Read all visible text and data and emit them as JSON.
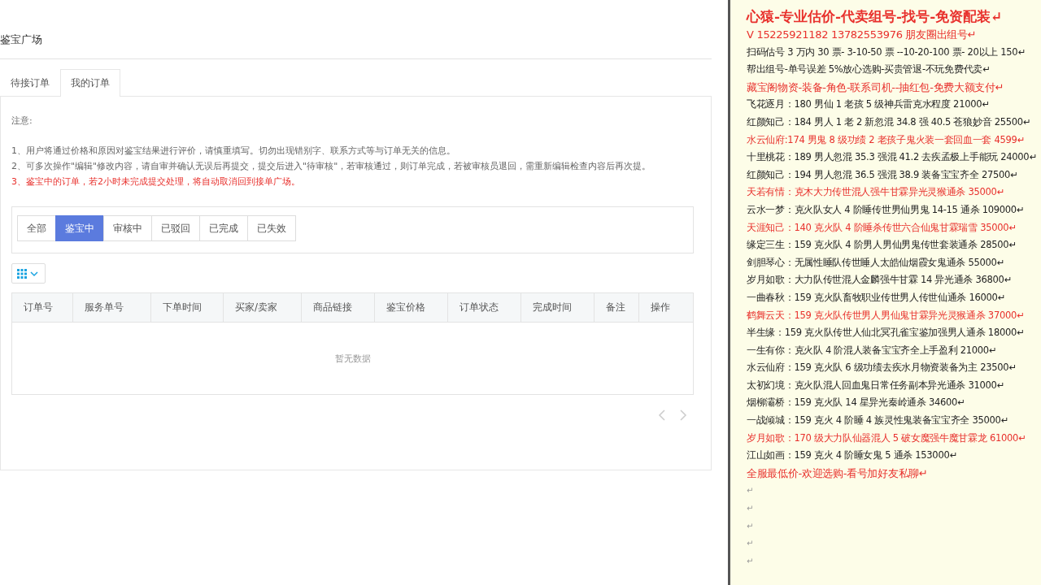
{
  "page_title": "鉴宝广场",
  "tabs": [
    {
      "label": "待接订单",
      "selected": false
    },
    {
      "label": "我的订单",
      "selected": true
    }
  ],
  "notice": {
    "heading": "注意:",
    "items": [
      {
        "text": "1、用户将通过价格和原因对鉴宝结果进行评价，请慎重填写。切勿出现错别字、联系方式等与订单无关的信息。",
        "warning": false
      },
      {
        "text": "2、可多次操作\"编辑\"修改内容，请自审并确认无误后再提交，提交后进入\"待审核\"，若审核通过，则订单完成，若被审核员退回，需重新编辑检查内容后再次提。",
        "warning": false
      },
      {
        "text": "3、鉴宝中的订单，若2小时未完成提交处理，将自动取消回到接单广场。",
        "warning": true
      }
    ]
  },
  "filters": [
    {
      "label": "全部",
      "selected": false
    },
    {
      "label": "鉴宝中",
      "selected": true
    },
    {
      "label": "审核中",
      "selected": false
    },
    {
      "label": "已驳回",
      "selected": false
    },
    {
      "label": "已完成",
      "selected": false
    },
    {
      "label": "已失效",
      "selected": false
    }
  ],
  "table": {
    "columns": [
      "订单号",
      "服务单号",
      "下单时间",
      "买家/卖家",
      "商品链接",
      "鉴宝价格",
      "订单状态",
      "完成时间",
      "备注",
      "操作"
    ],
    "empty_text": "暂无数据"
  },
  "document": {
    "title": "心猿-专业估价-代卖组号-找号-免资配装↵",
    "lines": [
      {
        "text": "V 15225921182    13782553976 朋友圈出组号↵",
        "color": "#e8302c",
        "kind": "large"
      },
      {
        "text": "扫码估号 3 万内 30 票- 3-10-50 票  --10-20-100 票- 20以上 150↵",
        "color": "#222222",
        "kind": "normal"
      },
      {
        "text": "帮出组号-单号误差 5%放心选购-买贵管退-不玩免费代卖↵",
        "color": "#222222",
        "kind": "normal"
      },
      {
        "text": "藏宝阁物资-装备-角色-联系司机--抽红包-免费大额支付↵",
        "color": "#e8302c",
        "kind": "large"
      },
      {
        "text": "飞花逐月：180 男仙 1 老孩 5 级神兵雷克水程度 21000↵",
        "color": "#222222",
        "kind": "normal"
      },
      {
        "text": "红颜知己：184 男人 1 老 2 新忽混 34.8 强 40.5 苍狼妙音 25500↵",
        "color": "#222222",
        "kind": "normal"
      },
      {
        "text": "水云仙府:174 男鬼 8 级功绩 2 老孩子鬼火装一套回血一套 4599↵",
        "color": "#e8302c",
        "kind": "normal"
      },
      {
        "text": "十里桃花：189 男人忽混 35.3 强混 41.2 去疾孟极上手能玩 24000↵",
        "color": "#222222",
        "kind": "normal"
      },
      {
        "text": "红颜知己：194 男人忽混 36.5 强混 38.9 装备宝宝齐全 27500↵",
        "color": "#222222",
        "kind": "normal"
      },
      {
        "text": "天若有情：克木大力传世混人强牛甘霖异光灵猴通杀 35000↵",
        "color": "#e8302c",
        "kind": "normal"
      },
      {
        "text": "云水一梦：克火队女人 4 阶睡传世男仙男鬼 14-15 通杀 109000↵",
        "color": "#222222",
        "kind": "normal"
      },
      {
        "text": "天涯知己：140 克火队 4 阶睡杀传世六合仙鬼甘霖瑞雪 35000↵",
        "color": "#e8302c",
        "kind": "normal"
      },
      {
        "text": "缘定三生：159 克火队 4 阶男人男仙男鬼传世套装通杀 28500↵",
        "color": "#222222",
        "kind": "normal"
      },
      {
        "text": "剑胆琴心：无属性睡队传世睡人太皓仙烟霞女鬼通杀 55000↵",
        "color": "#222222",
        "kind": "normal"
      },
      {
        "text": "岁月如歌：大力队传世混人金麟强牛甘霖 14 异光通杀 36800↵",
        "color": "#222222",
        "kind": "normal"
      },
      {
        "text": "一曲春秋：159 克火队畜牧职业传世男人传世仙通杀 16000↵",
        "color": "#222222",
        "kind": "normal"
      },
      {
        "text": "鹤舞云天：159 克火队传世男人男仙鬼甘霖异光灵猴通杀 37000↵",
        "color": "#e8302c",
        "kind": "normal"
      },
      {
        "text": "半生缘：159 克火队传世人仙北冥孔雀宝鉴加强男人通杀 18000↵",
        "color": "#222222",
        "kind": "normal"
      },
      {
        "text": "一生有你：克火队 4 阶混人装备宝宝齐全上手盈利 21000↵",
        "color": "#222222",
        "kind": "normal"
      },
      {
        "text": "水云仙府：159 克火队 6 级功绩去疾水月物资装备为主 23500↵",
        "color": "#222222",
        "kind": "normal"
      },
      {
        "text": "太初幻境：克火队混人回血鬼日常任务副本异光通杀 31000↵",
        "color": "#222222",
        "kind": "normal"
      },
      {
        "text": "烟柳灞桥：159 克火队 14 星异光秦岭通杀 34600↵",
        "color": "#222222",
        "kind": "normal"
      },
      {
        "text": "一战倾城：159 克火 4 阶睡 4 族灵性鬼装备宝宝齐全 35000↵",
        "color": "#222222",
        "kind": "normal"
      },
      {
        "text": "岁月如歌：170 级大力队仙器混人 5 破女魔强牛魔甘霖龙 61000↵",
        "color": "#e8302c",
        "kind": "normal"
      },
      {
        "text": "江山如画：159 克火 4 阶睡女鬼 5 通杀 153000↵",
        "color": "#222222",
        "kind": "normal"
      },
      {
        "text": "全服最低价-欢迎选购-看号加好友私聊↵",
        "color": "#e8302c",
        "kind": "large"
      },
      {
        "text": "↵",
        "kind": "mark"
      },
      {
        "text": "↵",
        "kind": "mark"
      },
      {
        "text": "↵",
        "kind": "mark"
      },
      {
        "text": "↵",
        "kind": "mark"
      },
      {
        "text": "↵",
        "kind": "mark"
      }
    ]
  }
}
